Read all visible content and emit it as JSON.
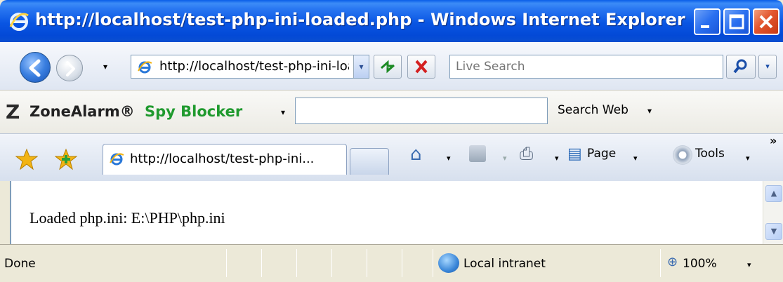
{
  "window": {
    "title": "http://localhost/test-php-ini-loaded.php - Windows Internet Explorer",
    "minimize_glyph": "",
    "maximize_glyph": "",
    "close_glyph": ""
  },
  "address_bar": {
    "url": "http://localhost/test-php-ini-loaded.php",
    "dropdown_glyph": "▾"
  },
  "search": {
    "placeholder": "Live Search",
    "go_glyph": "⚲",
    "dropdown_glyph": "▾"
  },
  "zonealarm": {
    "logo_mark": "Z",
    "brand": "ZoneAlarm®",
    "product": "Spy Blocker",
    "search_label": "Search Web",
    "dropdown_glyph": "▾",
    "search_value": ""
  },
  "tabs": [
    {
      "label": "http://localhost/test-php-ini...",
      "active": true
    }
  ],
  "command_bar": {
    "page_label": "Page",
    "tools_label": "Tools",
    "more_glyph": "»",
    "dropdown_glyph": "▾",
    "home_glyph": "⌂",
    "print_glyph": "⎙",
    "page_glyph": "▤"
  },
  "content": {
    "text": "Loaded php.ini: E:\\PHP\\php.ini"
  },
  "status_bar": {
    "status": "Done",
    "zone": "Local intranet",
    "zoom": "100%",
    "zoom_glyph": "⊕",
    "dropdown_glyph": "▾"
  },
  "scrollbar": {
    "up_glyph": "▲",
    "down_glyph": "▼"
  }
}
